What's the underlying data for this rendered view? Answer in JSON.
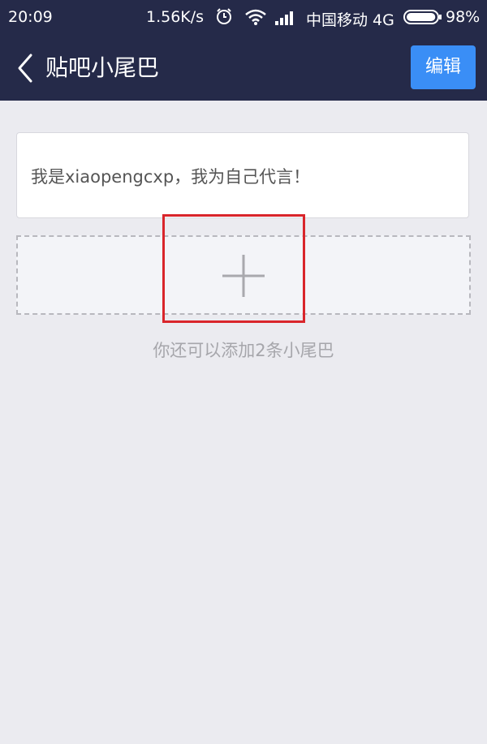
{
  "status_bar": {
    "time": "20:09",
    "net_speed": "1.56K/s",
    "alarm_icon": "alarm-clock-icon",
    "wifi_icon": "wifi-icon",
    "signal_icon": "cell-signal-icon",
    "carrier": "中国移动 4G",
    "battery_icon": "battery-icon",
    "battery_percent": "98%",
    "battery_level": 0.98
  },
  "nav": {
    "back_icon": "chevron-left-icon",
    "title": "贴吧小尾巴",
    "edit_label": "编辑"
  },
  "tails": [
    {
      "text": "我是xiaopengcxp，我为自己代言！"
    }
  ],
  "add_tail": {
    "icon": "plus-icon",
    "highlight_color": "#d9252b"
  },
  "hint": "你还可以添加2条小尾巴",
  "colors": {
    "header_bg": "#252a49",
    "accent": "#3a8ef6",
    "page_bg": "#ebebf0"
  }
}
